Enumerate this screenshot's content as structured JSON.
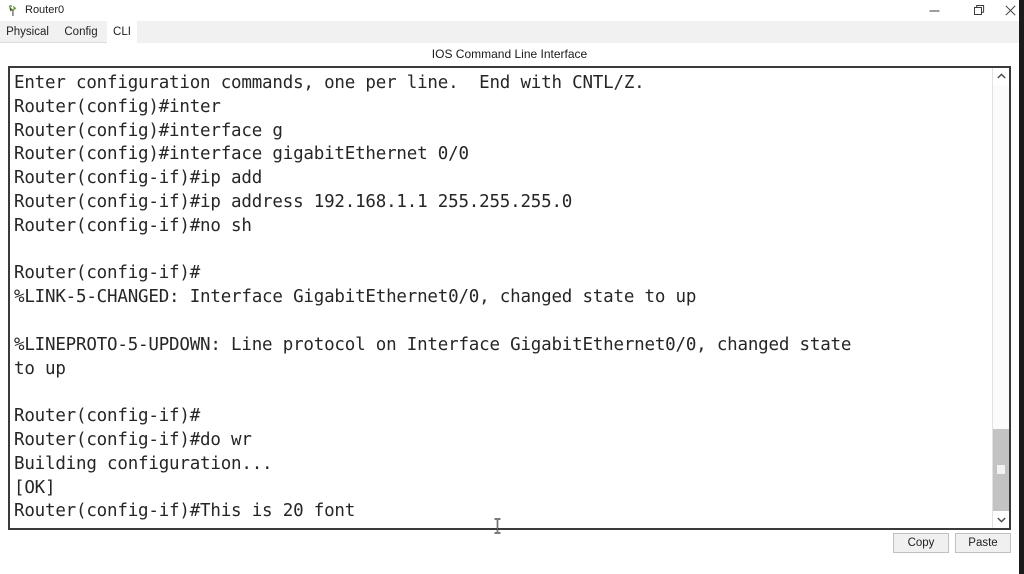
{
  "window": {
    "title": "Router0",
    "icon": "router-device-icon",
    "controls": {
      "minimize": "minimize-icon",
      "maximize": "restore-icon",
      "close": "close-icon"
    }
  },
  "tabs": [
    {
      "id": "physical",
      "label": "Physical",
      "active": false
    },
    {
      "id": "config",
      "label": "Config",
      "active": false
    },
    {
      "id": "cli",
      "label": "CLI",
      "active": true
    }
  ],
  "panel": {
    "title": "IOS Command Line Interface"
  },
  "terminal": {
    "lines": [
      "Enter configuration commands, one per line.  End with CNTL/Z.",
      "Router(config)#inter",
      "Router(config)#interface g",
      "Router(config)#interface gigabitEthernet 0/0",
      "Router(config-if)#ip add",
      "Router(config-if)#ip address 192.168.1.1 255.255.255.0",
      "Router(config-if)#no sh",
      "",
      "Router(config-if)#",
      "%LINK-5-CHANGED: Interface GigabitEthernet0/0, changed state to up",
      "",
      "%LINEPROTO-5-UPDOWN: Line protocol on Interface GigabitEthernet0/0, changed state",
      "to up",
      "",
      "Router(config-if)#",
      "Router(config-if)#do wr",
      "Building configuration...",
      "[OK]",
      "Router(config-if)#This is 20 font"
    ],
    "text_color": "#262626",
    "background_color": "#ffffff"
  },
  "scrollbar": {
    "up_arrow": "chevron-up-icon",
    "down_arrow": "chevron-down-icon",
    "thumb_position_percent": 84
  },
  "footer": {
    "copy_label": "Copy",
    "paste_label": "Paste"
  },
  "cursor": {
    "type": "i-beam-text-cursor"
  }
}
